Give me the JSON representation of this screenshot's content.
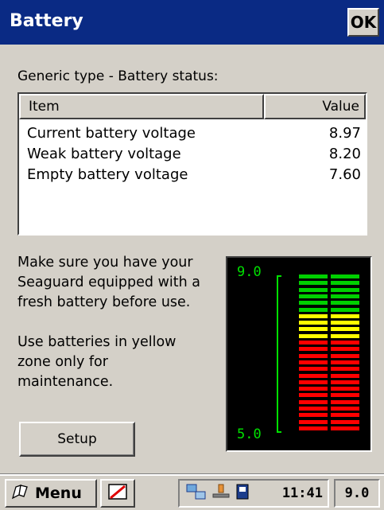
{
  "window": {
    "title": "Battery",
    "ok_label": "OK"
  },
  "status_heading": "Generic type - Battery status:",
  "table": {
    "columns": [
      "Item",
      "Value"
    ],
    "rows": [
      {
        "item": "Current battery voltage",
        "value": "8.97"
      },
      {
        "item": "Weak battery voltage",
        "value": "8.20"
      },
      {
        "item": "Empty battery voltage",
        "value": "7.60"
      }
    ]
  },
  "notes": {
    "fresh_battery": [
      "Make sure you have your",
      "Seaguard equipped with a",
      "fresh battery before use."
    ],
    "yellow_zone": [
      "Use batteries in yellow",
      "zone only for",
      "maintenance."
    ]
  },
  "setup_label": "Setup",
  "gauge": {
    "top_label": "9.0",
    "bottom_label": "5.0",
    "segments": {
      "green": 6,
      "yellow": 4,
      "red": 14
    },
    "colors": {
      "green": "#00d000",
      "yellow": "#ffff00",
      "red": "#ff0000"
    }
  },
  "taskbar": {
    "start_label": "Menu",
    "clock": "11:41",
    "voltage": "9.0"
  },
  "colors": {
    "titlebar": "#0a2a84",
    "chrome": "#d4d0c8"
  }
}
